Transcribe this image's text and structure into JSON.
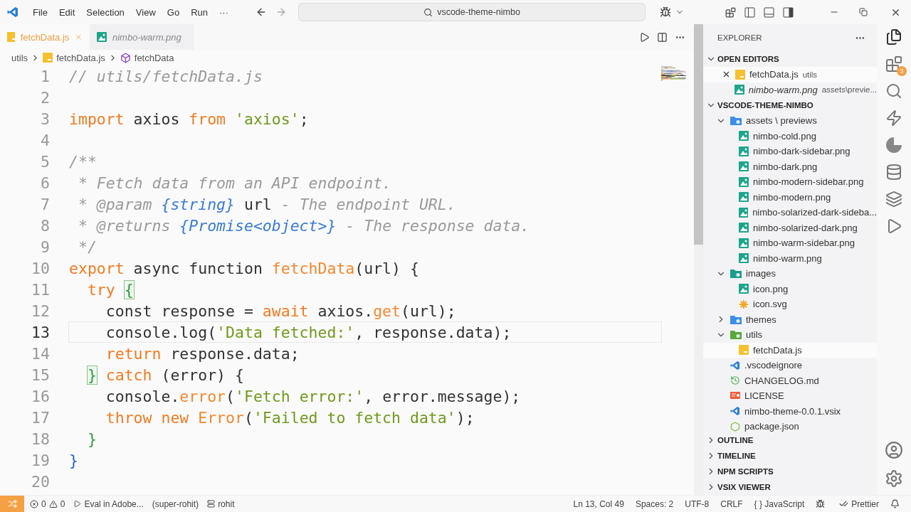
{
  "title_bar": {
    "menu": [
      "File",
      "Edit",
      "Selection",
      "View",
      "Go",
      "Run",
      "···"
    ],
    "search": "vscode-theme-nimbo"
  },
  "tabs": [
    {
      "label": "fetchData.js",
      "kind": "js",
      "selected": true
    },
    {
      "label": "nimbo-warm.png",
      "kind": "image",
      "selected": false
    }
  ],
  "breadcrumbs": [
    {
      "label": "utils",
      "kind": "folder"
    },
    {
      "label": "fetchData.js",
      "kind": "js"
    },
    {
      "label": "fetchData",
      "kind": "symbol"
    }
  ],
  "editor": {
    "lines": [
      {
        "number": "1",
        "current": false,
        "tokens": [
          {
            "kind": "comment",
            "text": "// utils/fetchData.js"
          }
        ]
      },
      {
        "number": "2",
        "current": false
      },
      {
        "number": "3",
        "current": false,
        "tokens": [
          {
            "kind": "keyword",
            "text": "import"
          },
          {
            "kind": "plain",
            "text": " axios "
          },
          {
            "kind": "keyword",
            "text": "from "
          },
          {
            "kind": "string",
            "text": "'axios'"
          },
          {
            "kind": "plain",
            "text": ";"
          }
        ]
      },
      {
        "number": "4",
        "current": false
      },
      {
        "number": "5",
        "current": false,
        "tokens": [
          {
            "kind": "comment",
            "text": "/**"
          }
        ]
      },
      {
        "number": "6",
        "current": false,
        "tokens": [
          {
            "kind": "comment",
            "text": " * Fetch data from an API endpoint."
          }
        ]
      },
      {
        "number": "7",
        "current": false,
        "tokens": [
          {
            "kind": "comment",
            "text": " * @param "
          },
          {
            "kind": "type",
            "text": "{string}"
          },
          {
            "kind": "plain",
            "text": " url"
          },
          {
            "kind": "comment",
            "text": " - The endpoint URL."
          }
        ]
      },
      {
        "number": "8",
        "current": false,
        "tokens": [
          {
            "kind": "comment",
            "text": " * @returns "
          },
          {
            "kind": "type",
            "text": "{Promise<object>}"
          },
          {
            "kind": "comment",
            "text": " - The response data."
          }
        ]
      },
      {
        "number": "9",
        "current": false,
        "tokens": [
          {
            "kind": "comment",
            "text": " */"
          }
        ]
      },
      {
        "number": "10",
        "current": false,
        "tokens": [
          {
            "kind": "keyword",
            "text": "export"
          },
          {
            "kind": "plain",
            "text": " async function "
          },
          {
            "kind": "function",
            "text": "fetchData"
          },
          {
            "kind": "plain",
            "text": "(url) {"
          }
        ]
      },
      {
        "number": "11",
        "current": false,
        "tokens": [
          {
            "kind": "keyword",
            "text": "  try "
          },
          {
            "kind": "bracket-match",
            "text": "{"
          }
        ]
      },
      {
        "number": "12",
        "current": false,
        "tokens": [
          {
            "kind": "plain",
            "text": "    const response = "
          },
          {
            "kind": "keyword",
            "text": "await"
          },
          {
            "kind": "plain",
            "text": " axios."
          },
          {
            "kind": "function",
            "text": "get"
          },
          {
            "kind": "plain",
            "text": "(url);"
          }
        ]
      },
      {
        "number": "13",
        "current": true,
        "tokens": [
          {
            "kind": "plain",
            "text": "    console.log("
          },
          {
            "kind": "string",
            "text": "'Data fetched:'"
          },
          {
            "kind": "plain",
            "text": ", response.data);"
          }
        ]
      },
      {
        "number": "14",
        "current": false,
        "tokens": [
          {
            "kind": "keyword",
            "text": "    return"
          },
          {
            "kind": "plain",
            "text": " response.data;"
          }
        ]
      },
      {
        "number": "15",
        "current": false,
        "tokens": [
          {
            "kind": "bracket-match",
            "text": "  }"
          },
          {
            "kind": "keyword",
            "text": " catch"
          },
          {
            "kind": "plain",
            "text": " (error) {"
          }
        ]
      },
      {
        "number": "16",
        "current": false,
        "tokens": [
          {
            "kind": "plain",
            "text": "    console."
          },
          {
            "kind": "function",
            "text": "error"
          },
          {
            "kind": "plain",
            "text": "("
          },
          {
            "kind": "string",
            "text": "'Fetch error:'"
          },
          {
            "kind": "plain",
            "text": ", error.message);"
          }
        ]
      },
      {
        "number": "17",
        "current": false,
        "tokens": [
          {
            "kind": "keyword",
            "text": "    throw new "
          },
          {
            "kind": "function",
            "text": "Error"
          },
          {
            "kind": "plain",
            "text": "("
          },
          {
            "kind": "string",
            "text": "'Failed to fetch data'"
          },
          {
            "kind": "plain",
            "text": ");"
          }
        ]
      },
      {
        "number": "18",
        "current": false,
        "tokens": [
          {
            "kind": "bracket-green",
            "text": "  }"
          }
        ]
      },
      {
        "number": "19",
        "current": false,
        "tokens": [
          {
            "kind": "bracket-blue",
            "text": "}"
          }
        ]
      },
      {
        "number": "20",
        "current": false
      }
    ]
  },
  "explorer": {
    "title": "EXPLORER",
    "open_editors": {
      "title": "OPEN EDITORS",
      "expanded": true,
      "items": [
        {
          "label": "fetchData.js",
          "detail": "utils",
          "kind": "js",
          "preview": false,
          "selected": true
        },
        {
          "label": "nimbo-warm.png",
          "detail": "assets\\previe...",
          "kind": "image",
          "preview": true,
          "selected": false
        }
      ]
    },
    "project": {
      "title": "VSCODE-THEME-NIMBO",
      "expanded": true,
      "children": [
        {
          "label": "assets \\ previews",
          "kind": "folder-blue",
          "expanded": true,
          "children": [
            {
              "label": "nimbo-cold.png",
              "kind": "image"
            },
            {
              "label": "nimbo-dark-sidebar.png",
              "kind": "image"
            },
            {
              "label": "nimbo-dark.png",
              "kind": "image"
            },
            {
              "label": "nimbo-modern-sidebar.png",
              "kind": "image"
            },
            {
              "label": "nimbo-modern.png",
              "kind": "image"
            },
            {
              "label": "nimbo-solarized-dark-sideba...",
              "kind": "image"
            },
            {
              "label": "nimbo-solarized-dark.png",
              "kind": "image"
            },
            {
              "label": "nimbo-warm-sidebar.png",
              "kind": "image"
            },
            {
              "label": "nimbo-warm.png",
              "kind": "image"
            }
          ]
        },
        {
          "label": "images",
          "kind": "folder-teal",
          "expanded": true,
          "children": [
            {
              "label": "icon.png",
              "kind": "image"
            },
            {
              "label": "icon.svg",
              "kind": "svg"
            }
          ]
        },
        {
          "label": "themes",
          "kind": "folder-blue",
          "expanded": false
        },
        {
          "label": "utils",
          "kind": "folder-green",
          "expanded": true,
          "children": [
            {
              "label": "fetchData.js",
              "kind": "js",
              "selected": true
            }
          ]
        },
        {
          "label": ".vscodeignore",
          "kind": "vscode"
        },
        {
          "label": "CHANGELOG.md",
          "kind": "changelog"
        },
        {
          "label": "LICENSE",
          "kind": "license"
        },
        {
          "label": "nimbo-theme-0.0.1.vsix",
          "kind": "vscode"
        },
        {
          "label": "package.json",
          "kind": "node"
        }
      ]
    },
    "sections": [
      {
        "title": "OUTLINE",
        "expanded": false
      },
      {
        "title": "TIMELINE",
        "expanded": false
      },
      {
        "title": "NPM SCRIPTS",
        "expanded": false
      },
      {
        "title": "VSIX VIEWER",
        "expanded": false
      }
    ]
  },
  "activity_bar": {
    "extensions_badge": "3"
  },
  "status_bar": {
    "errors": "0",
    "warnings": "0",
    "left": [
      "Eval in Adobe...",
      "(super-rohit)",
      "rohit"
    ],
    "right": [
      "Ln 13, Col 49",
      "Spaces: 2",
      "UTF-8",
      "CRLF",
      "{ } JavaScript",
      "Prettier"
    ]
  }
}
